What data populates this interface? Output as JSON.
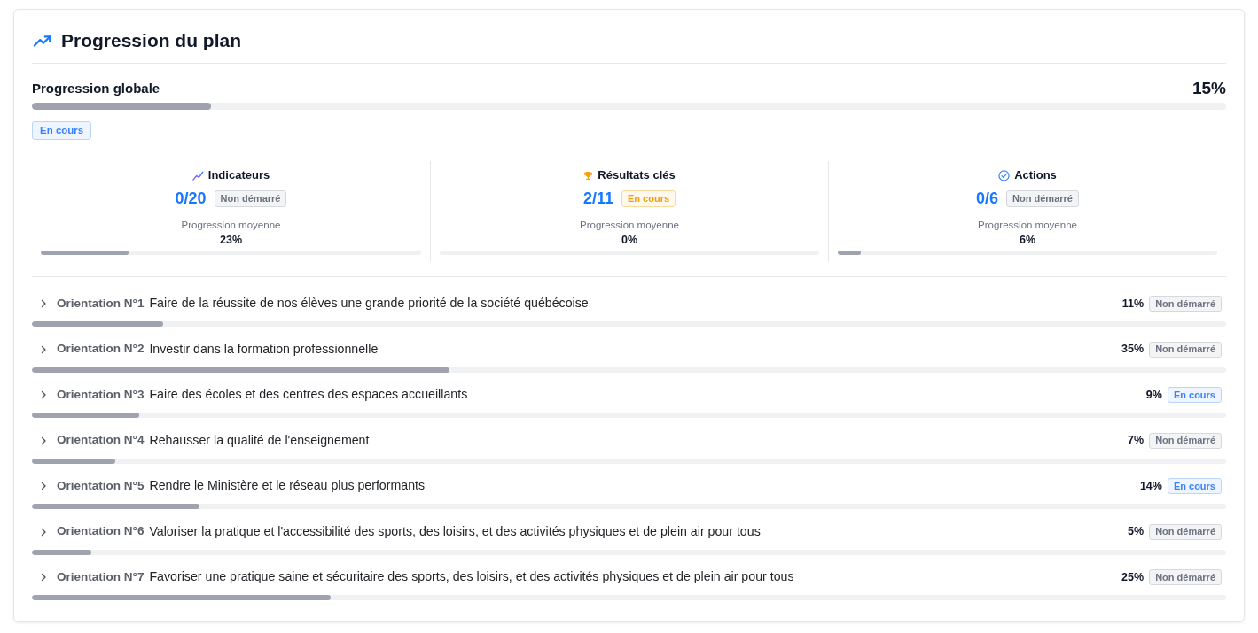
{
  "panel": {
    "title": "Progression du plan"
  },
  "global": {
    "label": "Progression globale",
    "value": "15%",
    "level": 0.15,
    "status": {
      "label": "En cours",
      "kind": "info"
    }
  },
  "stats": [
    {
      "kind": "indicators",
      "title": "Indicateurs",
      "count": "0/20",
      "status": {
        "label": "Non démarré",
        "kind": "neutral"
      },
      "avg_label": "Progression moyenne",
      "avg_value": "23%",
      "level": 0.23
    },
    {
      "kind": "key_results",
      "title": "Résultats clés",
      "count": "2/11",
      "status": {
        "label": "En cours",
        "kind": "warning"
      },
      "avg_label": "Progression moyenne",
      "avg_value": "0%",
      "level": 0
    },
    {
      "kind": "actions",
      "title": "Actions",
      "count": "0/6",
      "status": {
        "label": "Non démarré",
        "kind": "neutral"
      },
      "avg_label": "Progression moyenne",
      "avg_value": "6%",
      "level": 0.06
    }
  ],
  "orientations": [
    {
      "label": "Orientation N°1",
      "title": "Faire de la réussite de nos élèves une grande priorité de la société québécoise",
      "value": "11%",
      "level": 0.11,
      "expanded": false,
      "status": {
        "label": "Non démarré",
        "kind": "neutral"
      }
    },
    {
      "label": "Orientation N°2",
      "title": "Investir dans la formation professionnelle",
      "value": "35%",
      "level": 0.35,
      "expanded": false,
      "status": {
        "label": "Non démarré",
        "kind": "neutral"
      }
    },
    {
      "label": "Orientation N°3",
      "title": "Faire des écoles et des centres des espaces accueillants",
      "value": "9%",
      "level": 0.09,
      "expanded": false,
      "status": {
        "label": "En cours",
        "kind": "info"
      }
    },
    {
      "label": "Orientation N°4",
      "title": "Rehausser la qualité de l'enseignement",
      "value": "7%",
      "level": 0.07,
      "expanded": false,
      "status": {
        "label": "Non démarré",
        "kind": "neutral"
      }
    },
    {
      "label": "Orientation N°5",
      "title": "Rendre le Ministère et le réseau plus performants",
      "value": "14%",
      "level": 0.14,
      "expanded": false,
      "status": {
        "label": "En cours",
        "kind": "info"
      }
    },
    {
      "label": "Orientation N°6",
      "title": "Valoriser la pratique et l'accessibilité des sports, des loisirs, et des activités physiques et de plein air pour tous",
      "value": "5%",
      "level": 0.05,
      "expanded": false,
      "status": {
        "label": "Non démarré",
        "kind": "neutral"
      }
    },
    {
      "label": "Orientation N°7",
      "title": "Favoriser une pratique saine et sécuritaire des sports, des loisirs, et des activités physiques et de plein air pour tous",
      "value": "25%",
      "level": 0.25,
      "expanded": false,
      "status": {
        "label": "Non démarré",
        "kind": "neutral"
      }
    }
  ]
}
